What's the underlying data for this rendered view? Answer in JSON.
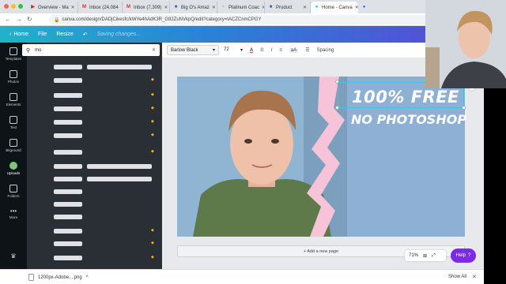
{
  "browser": {
    "tabs": [
      {
        "label": "Overview - Ma",
        "icon": "youtube-icon"
      },
      {
        "label": "Inbox (24,084",
        "icon": "gmail-icon"
      },
      {
        "label": "Inbox (7,309)",
        "icon": "gmail-icon"
      },
      {
        "label": "Big O's Amaz",
        "icon": "bookmark-icon"
      },
      {
        "label": "Platinum Coac",
        "icon": "page-icon"
      },
      {
        "label": "Product",
        "icon": "page-icon"
      },
      {
        "label": "Home - Canva",
        "icon": "canva-icon",
        "active": true
      }
    ],
    "url": "canva.com/design/DADjCikesfc/kWYe4hAdK3R_G92ZuNVkpQ/edit?category=tACZCnmCPGY"
  },
  "header": {
    "home_label": "Home",
    "file_label": "File",
    "resize_label": "Resize",
    "saving_label": "Saving changes..."
  },
  "rail": {
    "items": [
      {
        "label": "Templates",
        "icon": "templates-icon"
      },
      {
        "label": "Photos",
        "icon": "photos-icon"
      },
      {
        "label": "Elements",
        "icon": "elements-icon"
      },
      {
        "label": "Text",
        "icon": "text-icon"
      },
      {
        "label": "Bkground",
        "icon": "background-icon"
      },
      {
        "label": "Uploads",
        "icon": "uploads-icon",
        "active": true
      },
      {
        "label": "Folders",
        "icon": "folders-icon"
      },
      {
        "label": "More",
        "icon": "more-icon"
      }
    ]
  },
  "panel": {
    "search_value": "mo"
  },
  "toolbar": {
    "font_name": "Barlow Black",
    "font_size": "72",
    "spacing_label": "Spacing"
  },
  "canvas": {
    "title_line1": "100% FREE",
    "title_line2": "NO PHOTOSHOP",
    "add_page_label": "+ Add a new page",
    "zoom_label": "71%",
    "help_label": "Help",
    "help_mark": "?"
  },
  "downloads": {
    "file_name": "1200px-Adobe....png",
    "show_all_label": "Show All"
  },
  "colors": {
    "accent": "#7d2ae8",
    "header_start": "#1fb3c9",
    "header_end": "#5b47d6",
    "design_bg": "#8eb0d4",
    "brush_pink": "#f6c3d9"
  }
}
